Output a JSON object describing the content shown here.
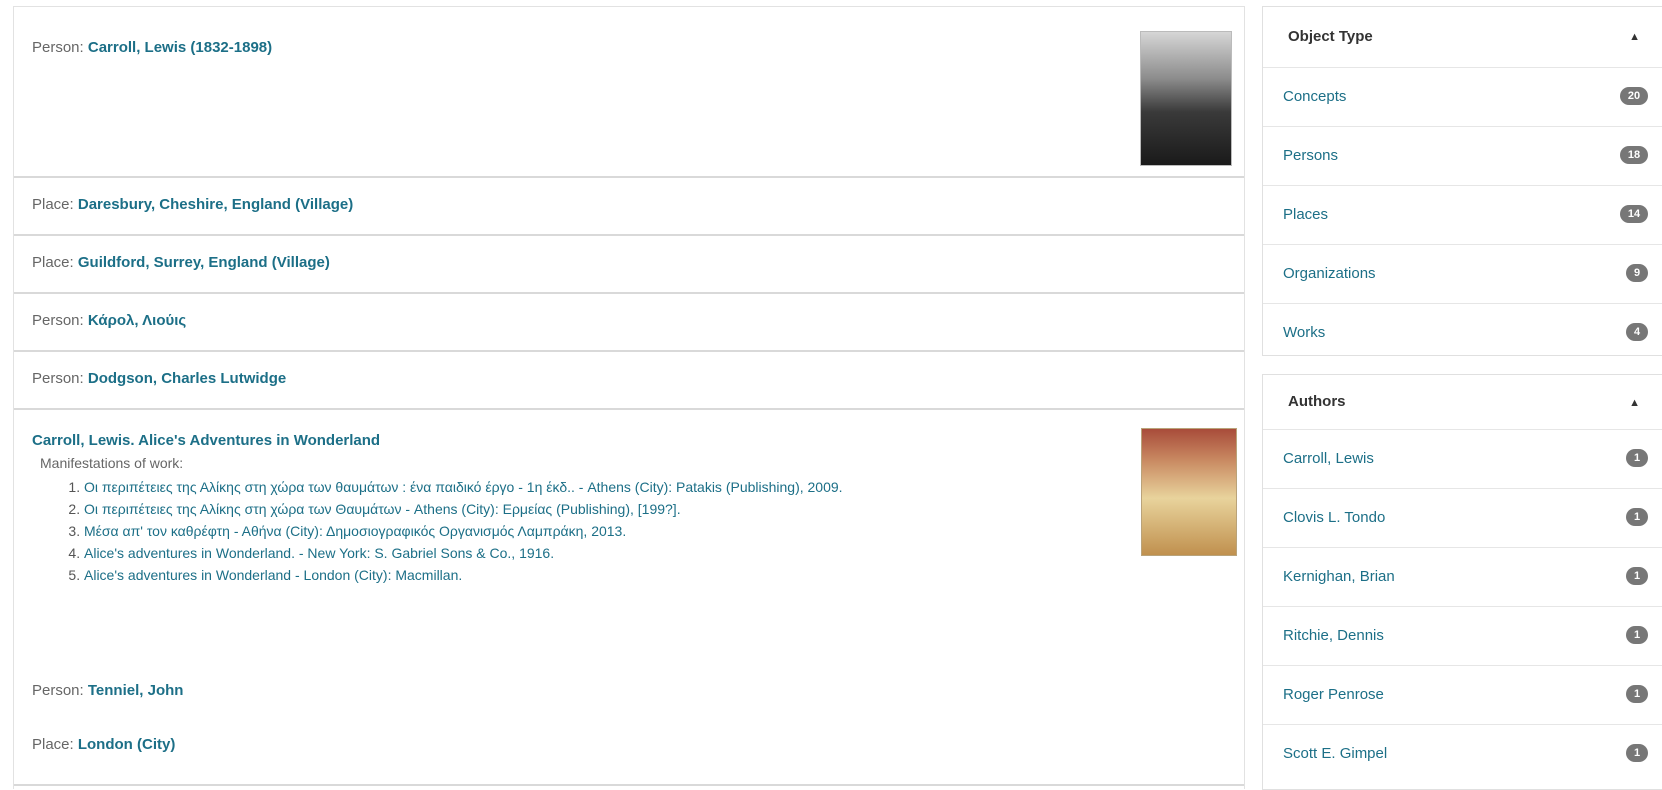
{
  "results": {
    "r1": {
      "label": "Person: ",
      "value": "Carroll, Lewis (1832-1898)"
    },
    "r2": {
      "label": "Place: ",
      "value": "Daresbury, Cheshire, England (Village)"
    },
    "r3": {
      "label": "Place: ",
      "value": "Guildford, Surrey, England (Village)"
    },
    "r4": {
      "label": "Person: ",
      "value": "Κάρολ, Λιούις"
    },
    "r5": {
      "label": "Person: ",
      "value": "Dodgson, Charles Lutwidge"
    },
    "r6": {
      "title": "Carroll, Lewis. Alice's Adventures in Wonderland",
      "subtitle": "Manifestations of work:",
      "items": [
        "Οι περιπέτειες της Αλίκης στη χώρα των θαυμάτων : ένα παιδικό έργο - 1η έκδ.. - Athens (City): Patakis (Publishing), 2009.",
        "Οι περιπέτειες της Αλίκης στη χώρα των Θαυμάτων - Athens (City): Ερμείας (Publishing), [199?].",
        "Μέσα απ' τον καθρέφτη - Αθήνα (City): Δημοσιογραφικός Οργανισμός Λαμπράκη, 2013.",
        "Alice's adventures in Wonderland. - New York: S. Gabriel Sons & Co., 1916.",
        "Alice's adventures in Wonderland - London (City): Macmillan."
      ]
    },
    "r7": {
      "label": "Person: ",
      "value": "Tenniel, John"
    },
    "r8": {
      "label": "Place: ",
      "value": "London (City)"
    }
  },
  "facets": {
    "object_type": {
      "title": "Object Type",
      "items": [
        {
          "name": "Concepts",
          "count": "20"
        },
        {
          "name": "Persons",
          "count": "18"
        },
        {
          "name": "Places",
          "count": "14"
        },
        {
          "name": "Organizations",
          "count": "9"
        },
        {
          "name": "Works",
          "count": "4"
        }
      ]
    },
    "authors": {
      "title": "Authors",
      "items": [
        {
          "name": "Carroll, Lewis",
          "count": "1"
        },
        {
          "name": "Clovis L. Tondo",
          "count": "1"
        },
        {
          "name": "Kernighan, Brian",
          "count": "1"
        },
        {
          "name": "Ritchie, Dennis",
          "count": "1"
        },
        {
          "name": "Roger Penrose",
          "count": "1"
        },
        {
          "name": "Scott E. Gimpel",
          "count": "1"
        }
      ]
    }
  }
}
